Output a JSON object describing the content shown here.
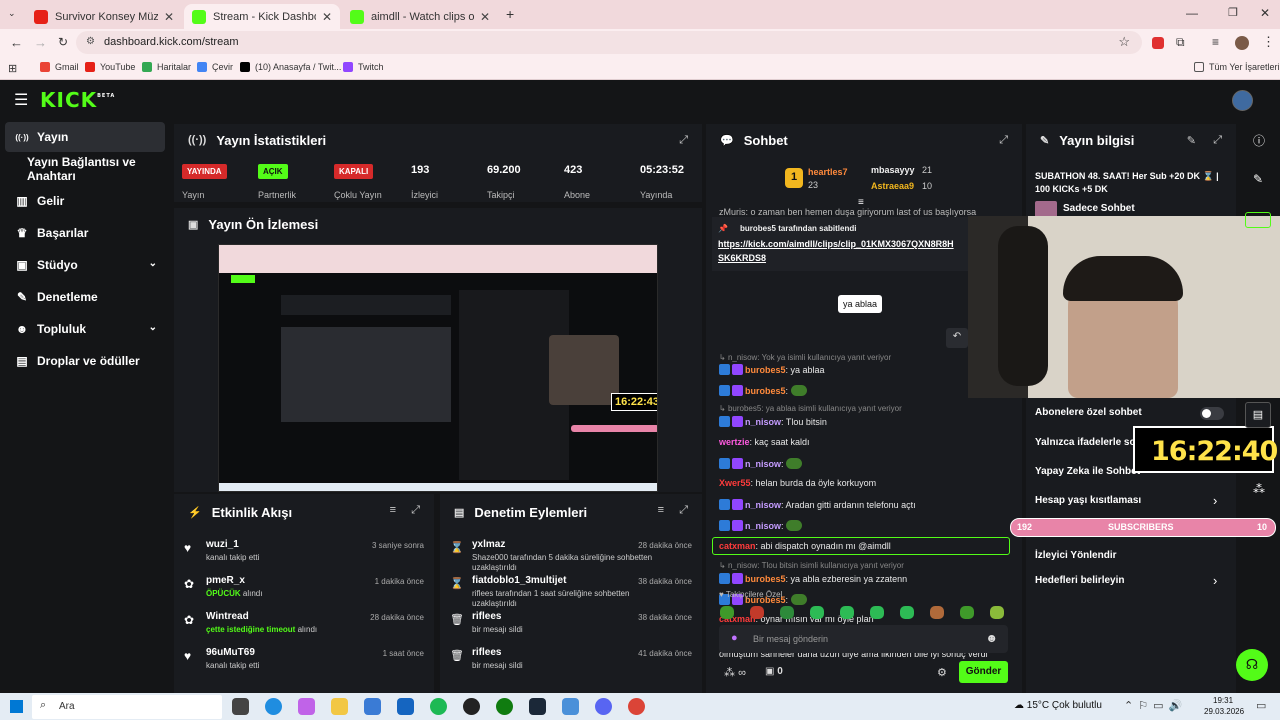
{
  "browser": {
    "tabs": [
      {
        "title": "Survivor Konsey Müziği (Uzun V",
        "color": "#e62117"
      },
      {
        "title": "Stream - Kick Dashboard",
        "color": "#53fc18"
      },
      {
        "title": "aimdll - Watch clips on Kick",
        "color": "#53fc18"
      }
    ],
    "url": "dashboard.kick.com/stream",
    "bookmarks": [
      "Gmail",
      "YouTube",
      "Haritalar",
      "Çevir",
      "(10) Anasayfa / Twit...",
      "Twitch"
    ],
    "all_bookmarks": "Tüm Yer İşaretleri"
  },
  "app": {
    "logo": "KICK",
    "logo_sup": "BETA",
    "accent": "#53fc18"
  },
  "sidebar": {
    "items": [
      {
        "label": "Yayın",
        "icon": "broadcast-icon",
        "glyph": "((·))"
      },
      {
        "label": "Yayın Bağlantısı ve Anahtarı",
        "icon": "",
        "glyph": ""
      },
      {
        "label": "Gelir",
        "icon": "wallet-icon",
        "glyph": "▥"
      },
      {
        "label": "Başarılar",
        "icon": "trophy-icon",
        "glyph": "♛"
      },
      {
        "label": "Stüdyo",
        "icon": "studio-icon",
        "glyph": "▣"
      },
      {
        "label": "Denetleme",
        "icon": "wrench-icon",
        "glyph": "✎"
      },
      {
        "label": "Topluluk",
        "icon": "community-icon",
        "glyph": "☻"
      },
      {
        "label": "Droplar ve ödüller",
        "icon": "drops-icon",
        "glyph": "▤"
      }
    ]
  },
  "stats": {
    "title": "Yayın İstatistikleri",
    "items": [
      {
        "value": "YAYINDA",
        "label": "Yayın",
        "badge": true,
        "bg": "#d62a2a"
      },
      {
        "value": "AÇIK",
        "label": "Partnerlik",
        "badge": true,
        "bg": "#53fc18"
      },
      {
        "value": "KAPALI",
        "label": "Çoklu Yayın",
        "badge": true,
        "bg": "#d62a2a"
      },
      {
        "value": "193",
        "label": "İzleyici",
        "badge": false
      },
      {
        "value": "69.200",
        "label": "Takipçi",
        "badge": false
      },
      {
        "value": "423",
        "label": "Abone",
        "badge": false
      },
      {
        "value": "05:23:52",
        "label": "Yayında",
        "badge": false
      }
    ]
  },
  "preview": {
    "title": "Yayın Ön İzlemesi",
    "clock": "16:22:43"
  },
  "activity": {
    "title": "Etkinlik Akışı",
    "rows": [
      {
        "icon": "heart-icon",
        "glyph": "♥",
        "name": "wuzi_1",
        "desc": "kanalı takip etti",
        "time": "3 saniye sonra"
      },
      {
        "icon": "gift-icon",
        "glyph": "✿",
        "name": "pmeR_x",
        "desc": "ÖPÜCÜK",
        "desc2": " alındı",
        "time": "1 dakika önce"
      },
      {
        "icon": "gift-icon",
        "glyph": "✿",
        "name": "Wintread",
        "desc": "çette istediğine timeout",
        "desc2": " alındı",
        "time": "28 dakika önce"
      },
      {
        "icon": "heart-icon",
        "glyph": "♥",
        "name": "96uMuT69",
        "desc": "kanalı takip etti",
        "time": "1 saat önce"
      }
    ]
  },
  "moderation": {
    "title": "Denetim Eylemleri",
    "rows": [
      {
        "icon": "hourglass-icon",
        "glyph": "⌛",
        "name": "yxlmaz",
        "desc": "Shaze000 tarafından 5 dakika süreliğine sohbetten",
        "desc3": "uzaklaştırıldı",
        "time": "28 dakika önce"
      },
      {
        "icon": "hourglass-icon",
        "glyph": "⌛",
        "name": "fiatdoblo1_3multijet",
        "desc": "riflees tarafından 1 saat süreliğine sohbetten",
        "desc3": "uzaklaştırıldı",
        "time": "38 dakika önce"
      },
      {
        "icon": "trash-icon",
        "glyph": "🗑",
        "name": "riflees",
        "desc": "bir mesajı sildi",
        "desc3": "",
        "time": "38 dakika önce"
      },
      {
        "icon": "trash-icon",
        "glyph": "🗑",
        "name": "riflees",
        "desc": "bir mesajı sildi",
        "desc3": "",
        "time": "41 dakika önce"
      }
    ]
  },
  "chat": {
    "title": "Sohbet",
    "top": [
      {
        "name": "heartles7",
        "count": "23"
      },
      {
        "name": "mbasayyy",
        "count": "21"
      },
      {
        "name": "Astraeaa9",
        "count": "10"
      }
    ],
    "pinned_by": "burobes5 tarafından sabitlendi",
    "pinned_link": "https://kick.com/aimdll/clips/clip_01KMX3067QXN8R8H",
    "pinned_link2": "SK6KRDS8",
    "cut_line": "zMuris: o zaman ben hemen duşa giriyorum last of us başlıyorsa",
    "tooltip": "ya ablaa",
    "messages": [
      {
        "type": "reply",
        "text": "n_nisow: Yok ya isimli kullanıcıya yanıt veriyor"
      },
      {
        "type": "msg",
        "user": "burobes5",
        "color": "#ff8a3c",
        "text": ": ya ablaa"
      },
      {
        "type": "msg",
        "user": "burobes5",
        "color": "#ff8a3c",
        "text": ": ",
        "emote": true
      },
      {
        "type": "reply",
        "text": "burobes5: ya ablaa isimli kullanıcıya yanıt veriyor"
      },
      {
        "type": "msg",
        "user": "n_nisow",
        "color": "#c59cff",
        "text": ": Tlou bitsin"
      },
      {
        "type": "msg",
        "user": "wertzie",
        "color": "#ff5ae0",
        "text": ": kaç saat kaldı"
      },
      {
        "type": "msg",
        "user": "n_nisow",
        "color": "#c59cff",
        "text": ": ",
        "emote": true
      },
      {
        "type": "msg",
        "user": "Xwer55",
        "color": "#ff3b3b",
        "text": ": helan burda da öyle korkuyom"
      },
      {
        "type": "msg",
        "user": "n_nisow",
        "color": "#c59cff",
        "text": ": Aradan gitti ardanın telefonu açtı"
      },
      {
        "type": "msg",
        "user": "n_nisow",
        "color": "#c59cff",
        "text": ": ",
        "emote": true
      },
      {
        "type": "msg",
        "user": "catxman",
        "color": "#ff3b3b",
        "text": ": abi dispatch oynadın mı @aimdll",
        "highlight": true
      },
      {
        "type": "reply",
        "text": "n_nisow: Tlou bitsin isimli kullanıcıya yanıt veriyor"
      },
      {
        "type": "msg",
        "user": "burobes5",
        "color": "#ff8a3c",
        "text": ": ya abla ezberesin ya zzatenn"
      },
      {
        "type": "msg",
        "user": "burobes5",
        "color": "#ff8a3c",
        "text": ": ",
        "emote": true
      },
      {
        "type": "msg",
        "user": "catxman",
        "color": "#ff3b3b",
        "text": ": oynar mısın var mı öyle plan"
      },
      {
        "type": "msg",
        "user": "mmustafabeyh",
        "color": "#c59cff",
        "text": ": 2. editten hiç umudum yoktu kötü oldu diye stres"
      },
      {
        "type": "cont",
        "text": "olmuştum sahneler daha uzun diye ama ilkinden bile iyi sonuç verdi"
      }
    ],
    "followers_only": "Takipçilere Özel",
    "input_placeholder": "Bir mesaj gönderin",
    "points": "∞",
    "gifts": "0",
    "send": "Gönder"
  },
  "info": {
    "title": "Yayın bilgisi",
    "stream_title": "SUBATHON 48. SAAT! Her Sub +20 DK ⌛ | 100 KICKs +5 DK",
    "mode": "Sadece Sohbet",
    "rows": [
      {
        "label": "Abonelere özel sohbet",
        "toggle": true
      },
      {
        "label": "Yalnızca ifadelerle sohbet",
        "toggle": false
      },
      {
        "label": "Yapay Zeka ile Sohbet",
        "toggle": false
      },
      {
        "label": "Hesap yaşı kısıtlaması",
        "arrow": true
      },
      {
        "label": "İzleyici Yönlendir",
        "arrow": false
      },
      {
        "label": "Hedefleri belirleyin",
        "arrow": true
      }
    ],
    "clock": "16:22:40",
    "subs_left": "192",
    "subs_label": "SUBSCRIBERS",
    "subs_right": "10"
  },
  "taskbar": {
    "search": "Ara",
    "weather": "15°C  Çok bulutlu",
    "time": "19:31",
    "date": "29.03.2026"
  }
}
